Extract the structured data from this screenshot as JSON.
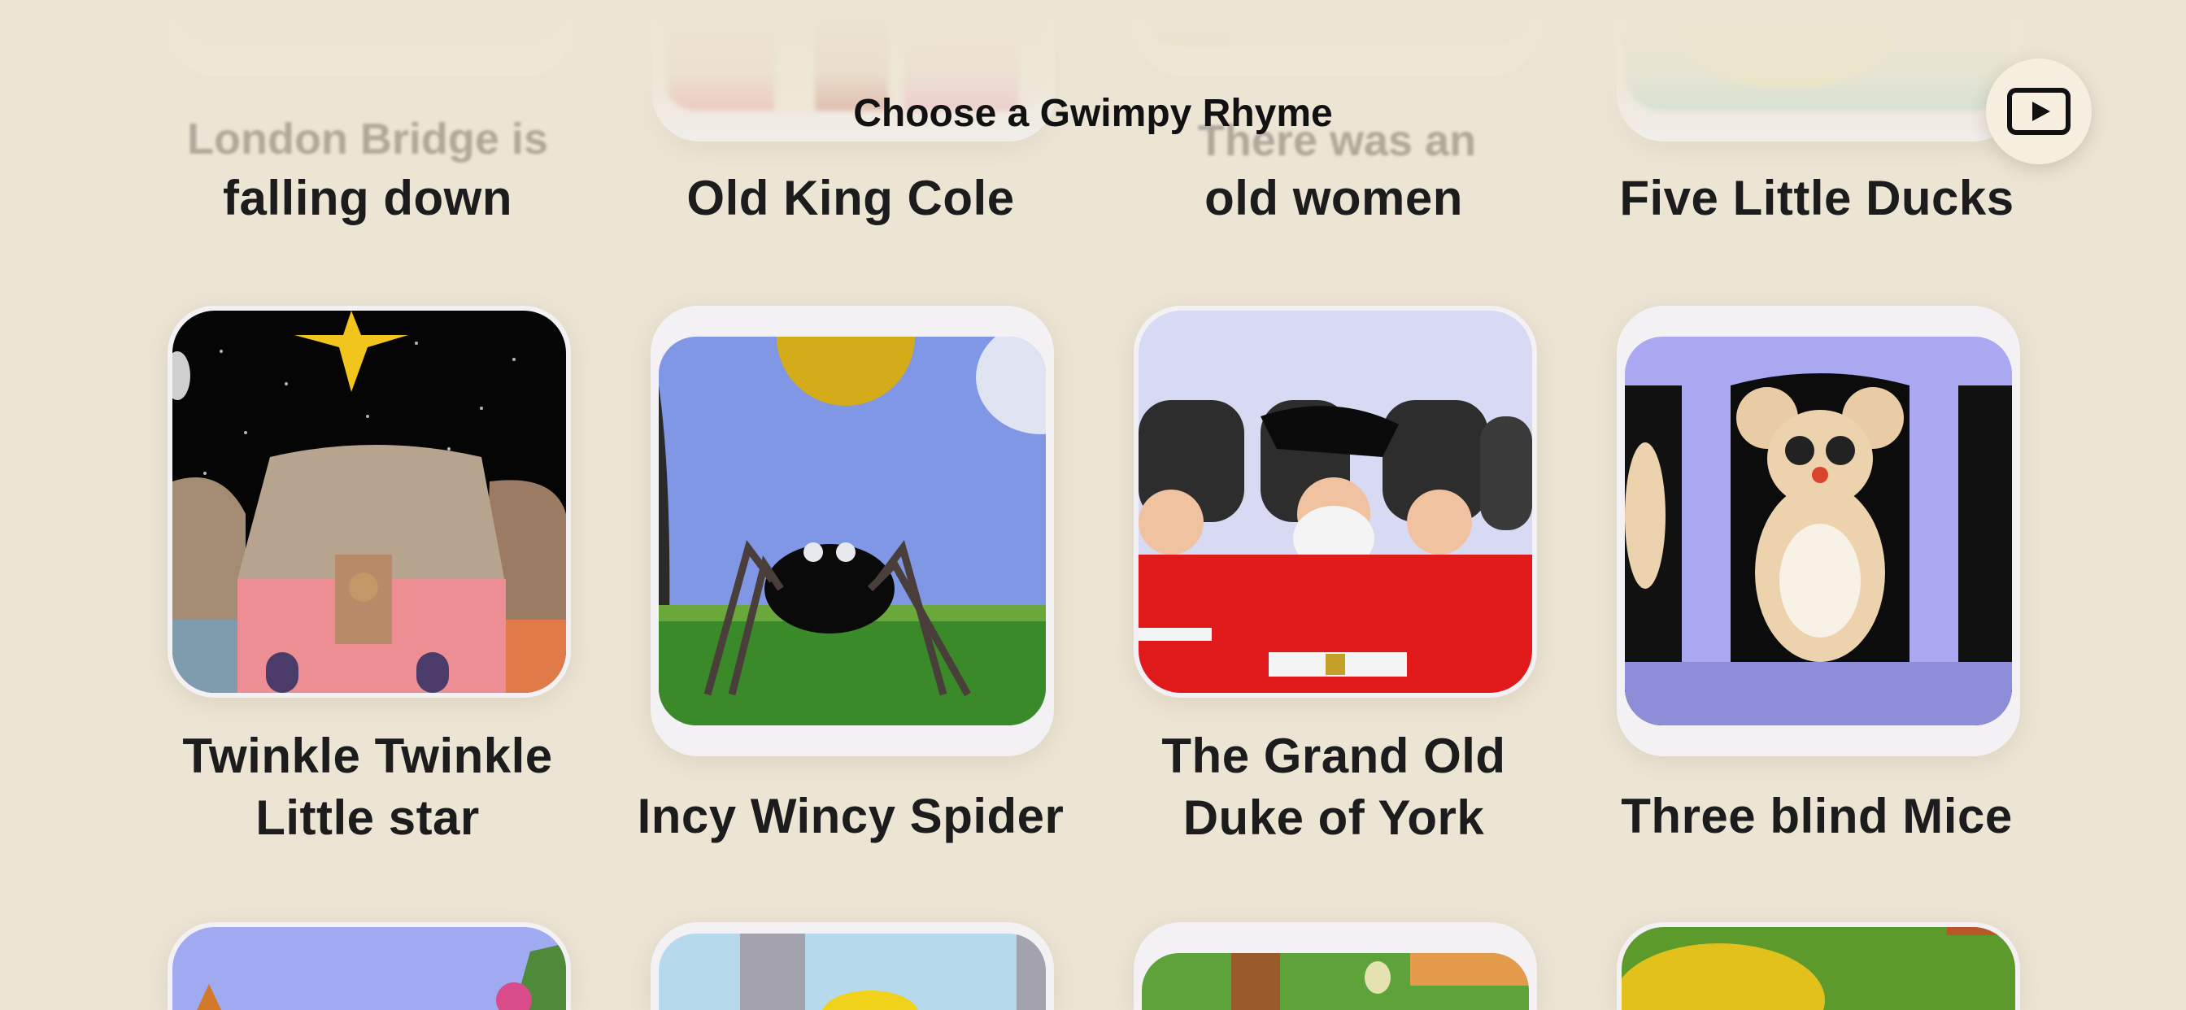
{
  "header": {
    "title": "Choose a Gwimpy Rhyme"
  },
  "top_row_partial_titles": [
    "London Bridge is",
    "",
    "There was an",
    ""
  ],
  "rows": [
    {
      "items": [
        {
          "label_lines": [
            "falling down"
          ]
        },
        {
          "label_lines": [
            "Old King Cole"
          ]
        },
        {
          "label_lines": [
            "old women"
          ]
        },
        {
          "label_lines": [
            "Five Little Ducks"
          ]
        }
      ]
    },
    {
      "items": [
        {
          "label_lines": [
            "Twinkle Twinkle",
            "Little star"
          ]
        },
        {
          "label_lines": [
            "Incy Wincy Spider"
          ]
        },
        {
          "label_lines": [
            "The Grand Old",
            "Duke of York"
          ]
        },
        {
          "label_lines": [
            "Three blind Mice"
          ]
        }
      ]
    }
  ],
  "play_button": {
    "icon": "play-video-icon"
  },
  "colors": {
    "background": "#ede5d4",
    "card": "#f3f1f4",
    "text": "#1c1c1c"
  }
}
